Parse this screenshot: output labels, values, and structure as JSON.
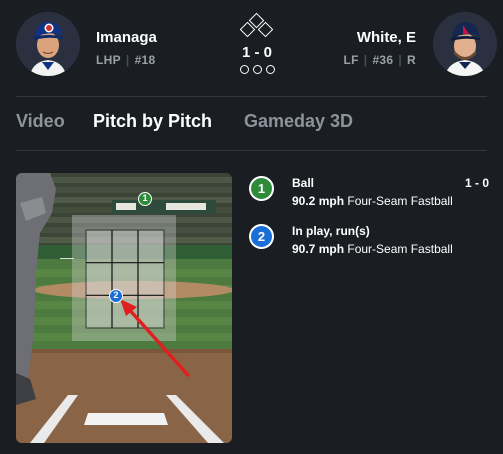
{
  "matchup": {
    "pitcher": {
      "name": "Imanaga",
      "hand": "LHP",
      "number": "#18"
    },
    "batter": {
      "name": "White, E",
      "position": "LF",
      "number": "#36",
      "bats": "R"
    },
    "count": "1 - 0",
    "bases": {
      "first": false,
      "second": false,
      "third": false
    },
    "outs": 0
  },
  "tabs": [
    {
      "label": "Video",
      "active": false
    },
    {
      "label": "Pitch by Pitch",
      "active": true
    },
    {
      "label": "Gameday 3D",
      "active": false
    }
  ],
  "zone": {
    "marker_1": "1",
    "marker_2": "2"
  },
  "pitches": [
    {
      "number": "1",
      "result": "Ball",
      "count": "1 - 0",
      "speed": "90.2 mph",
      "type": "Four-Seam Fastball",
      "color": "#2e8b3a"
    },
    {
      "number": "2",
      "result": "In play, run(s)",
      "count": "",
      "speed": "90.7 mph",
      "type": "Four-Seam Fastball",
      "color": "#1a6fd6"
    }
  ],
  "colors": {
    "ball_green": "#2e8b3a",
    "in_play_blue": "#1a6fd6",
    "annotation_red": "#e02020",
    "background": "#1a1d22"
  }
}
